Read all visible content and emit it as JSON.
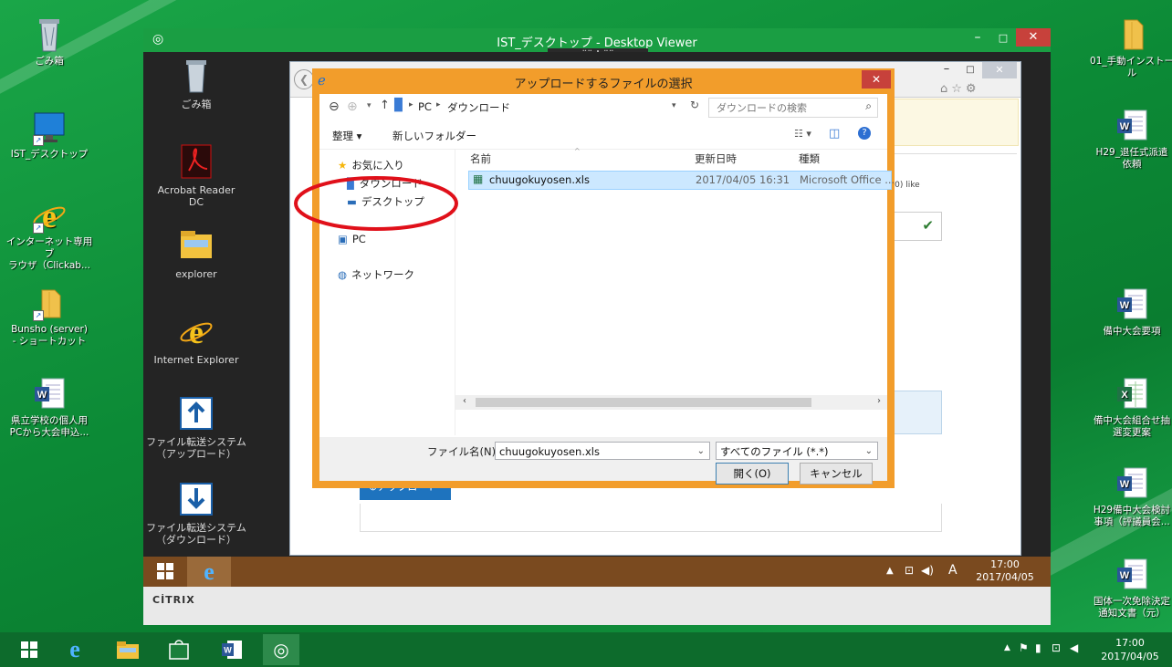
{
  "desktop": {
    "icons_left": [
      {
        "label": "ごみ箱",
        "icon": "recycle-bin-icon"
      },
      {
        "label": "IST_デスクトップ",
        "icon": "monitor-icon"
      },
      {
        "label": "インターネット専用ブ\nラウザ（Clickab...",
        "icon": "ie-icon"
      },
      {
        "label": "Bunsho (server)\n- ショートカット",
        "icon": "folder-icon"
      },
      {
        "label": "県立学校の個人用\nPCから大会申込...",
        "icon": "word-doc-icon"
      }
    ],
    "icons_right": [
      {
        "label": "01_手動インストール",
        "icon": "folder-icon"
      },
      {
        "label": "H29_退任式派遣\n依頼",
        "icon": "word-doc-icon"
      },
      {
        "label": "備中大会要項",
        "icon": "word-doc-icon"
      },
      {
        "label": "備中大会組合せ抽\n選変更案",
        "icon": "excel-doc-icon"
      },
      {
        "label": "H29備中大会検討\n事項（評議員会...",
        "icon": "word-doc-icon"
      },
      {
        "label": "国体一次免除決定\n通知文書（元）",
        "icon": "word-doc-icon"
      }
    ]
  },
  "viewer": {
    "title": "IST_デスクトップ - Desktop Viewer",
    "toolbar_handle": "⠿⠿ ⬇ ⠿⠿",
    "icons": [
      {
        "label": "ごみ箱",
        "icon": "recycle-bin-icon"
      },
      {
        "label": "Acrobat Reader\nDC",
        "icon": "acrobat-icon"
      },
      {
        "label": "explorer",
        "icon": "explorer-icon"
      },
      {
        "label": "Internet Explorer",
        "icon": "ie-icon"
      },
      {
        "label": "ファイル転送システム\n（アップロード）",
        "icon": "upload-icon"
      },
      {
        "label": "ファイル転送システム\n（ダウンロード）",
        "icon": "download-icon"
      }
    ],
    "inner_time": "17:00",
    "inner_date": "2017/04/05",
    "ime": "A",
    "citrix_label": "CİTRIX"
  },
  "browser": {
    "snippet_text": "ト。",
    "ua_text": "v:11.0) like",
    "upload_button": "アップロード"
  },
  "dialog": {
    "title": "アップロードするファイルの選択",
    "breadcrumb": [
      "PC",
      "ダウンロード"
    ],
    "search_placeholder": "ダウンロードの検索",
    "organize": "整理 ▾",
    "new_folder": "新しいフォルダー",
    "nav": {
      "favorites": "お気に入り",
      "downloads": "ダウンロード",
      "desktop": "デスクトップ",
      "pc": "PC",
      "network": "ネットワーク"
    },
    "columns": [
      "名前",
      "更新日時",
      "種類"
    ],
    "files": [
      {
        "name": "chuugokuyosen.xls",
        "date": "2017/04/05 16:31",
        "type": "Microsoft Office ..."
      }
    ],
    "filename_label": "ファイル名(N):",
    "filename_value": "chuugokuyosen.xls",
    "filetype": "すべてのファイル (*.*)",
    "open_button": "開く(O)",
    "cancel_button": "キャンセル"
  },
  "taskbar": {
    "time": "17:00",
    "date": "2017/04/05"
  },
  "colors": {
    "desktop_green": "#0c8a36",
    "viewer_title": "#1a9e43",
    "dialog_border": "#f29d2b",
    "close_red": "#c7413b",
    "selection": "#cce8ff",
    "annotation_red": "#e0101a"
  }
}
